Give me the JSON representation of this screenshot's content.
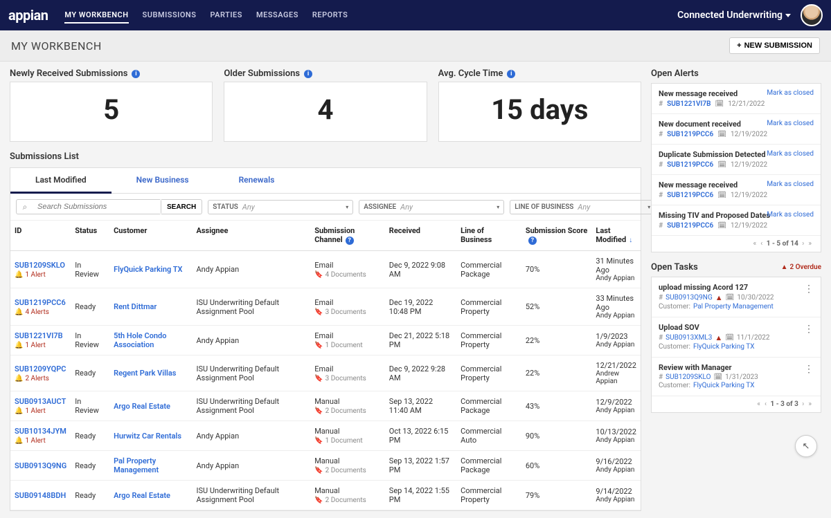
{
  "logo": "appian",
  "nav": [
    "MY WORKBENCH",
    "SUBMISSIONS",
    "PARTIES",
    "MESSAGES",
    "REPORTS"
  ],
  "nav_active": 0,
  "app_name": "Connected Underwriting",
  "page_title": "MY WORKBENCH",
  "new_submission_btn": "NEW SUBMISSION",
  "kpis": [
    {
      "title": "Newly Received Submissions",
      "value": "5"
    },
    {
      "title": "Older Submissions",
      "value": "4"
    },
    {
      "title": "Avg. Cycle Time",
      "value": "15 days"
    }
  ],
  "submissions_title": "Submissions List",
  "sub_tabs": [
    "Last Modified",
    "New Business",
    "Renewals"
  ],
  "sub_tab_active": 0,
  "search_placeholder": "Search Submissions",
  "search_btn": "SEARCH",
  "filters": {
    "status": {
      "label": "STATUS",
      "value": "Any"
    },
    "assignee": {
      "label": "ASSIGNEE",
      "value": "Any"
    },
    "lob": {
      "label": "LINE OF BUSINESS",
      "value": "Any"
    }
  },
  "columns": [
    "ID",
    "Status",
    "Customer",
    "Assignee",
    "Submission Channel",
    "Received",
    "Line of Business",
    "Submission Score",
    "Last Modified"
  ],
  "rows": [
    {
      "id": "SUB1209SKLO",
      "alert": "1 Alert",
      "status": "In Review",
      "customer": "FlyQuick Parking TX",
      "assignee": "Andy Appian",
      "channel": "Email",
      "docs": "4 Documents",
      "received": "Dec 9, 2022 9:08 AM",
      "lob": "Commercial Package",
      "score": "70%",
      "modified": "31 Minutes Ago",
      "mod_by": "Andy Appian"
    },
    {
      "id": "SUB1219PCC6",
      "alert": "4 Alerts",
      "status": "Ready",
      "customer": "Rent Dittmar",
      "assignee": "ISU Underwriting Default Assignment Pool",
      "channel": "Email",
      "docs": "3 Documents",
      "received": "Dec 19, 2022 10:48 PM",
      "lob": "Commercial Property",
      "score": "52%",
      "modified": "33 Minutes Ago",
      "mod_by": "Andy Appian"
    },
    {
      "id": "SUB1221VI7B",
      "alert": "1 Alert",
      "status": "In Review",
      "customer": "5th Hole Condo Association",
      "assignee": "Andy Appian",
      "channel": "Email",
      "docs": "1 Document",
      "received": "Dec 21, 2022 5:18 PM",
      "lob": "Commercial Property",
      "score": "22%",
      "modified": "1/9/2023",
      "mod_by": "Andy Appian"
    },
    {
      "id": "SUB1209YQPC",
      "alert": "2 Alerts",
      "status": "Ready",
      "customer": "Regent Park Villas",
      "assignee": "ISU Underwriting Default Assignment Pool",
      "channel": "Email",
      "docs": "3 Documents",
      "received": "Dec 9, 2022 9:28 AM",
      "lob": "Commercial Property",
      "score": "22%",
      "modified": "12/21/2022",
      "mod_by": "Andrew Appian"
    },
    {
      "id": "SUB0913AUCT",
      "alert": "1 Alert",
      "status": "In Review",
      "customer": "Argo Real Estate",
      "assignee": "ISU Underwriting Default Assignment Pool",
      "channel": "Manual",
      "docs": "2 Documents",
      "received": "Sep 13, 2022 11:40 AM",
      "lob": "Commercial Package",
      "score": "43%",
      "modified": "12/9/2022",
      "mod_by": "Andy Appian"
    },
    {
      "id": "SUB10134JYM",
      "alert": "1 Alert",
      "status": "Ready",
      "customer": "Hurwitz Car Rentals",
      "assignee": "Andy Appian",
      "channel": "Manual",
      "docs": "1 Document",
      "received": "Oct 13, 2022 6:15 PM",
      "lob": "Commercial Auto",
      "score": "90%",
      "modified": "10/13/2022",
      "mod_by": "Andy Appian"
    },
    {
      "id": "SUB0913Q9NG",
      "alert": "",
      "status": "Ready",
      "customer": "Pal Property Management",
      "assignee": "Andy Appian",
      "channel": "Manual",
      "docs": "2 Documents",
      "received": "Sep 13, 2022 1:57 PM",
      "lob": "Commercial Package",
      "score": "60%",
      "modified": "9/16/2022",
      "mod_by": "Andy Appian"
    },
    {
      "id": "SUB09148BDH",
      "alert": "",
      "status": "Ready",
      "customer": "Argo Real Estate",
      "assignee": "ISU Underwriting Default Assignment Pool",
      "channel": "Manual",
      "docs": "2 Documents",
      "received": "Sep 14, 2022 1:55 PM",
      "lob": "Commercial Property",
      "score": "79%",
      "modified": "9/14/2022",
      "mod_by": "Andy Appian"
    }
  ],
  "open_alerts_title": "Open Alerts",
  "mark_closed": "Mark as closed",
  "alerts": [
    {
      "title": "New message received",
      "sub": "SUB1221VI7B",
      "date": "12/21/2022"
    },
    {
      "title": "New document received",
      "sub": "SUB1219PCC6",
      "date": "12/19/2022"
    },
    {
      "title": "Duplicate Submission Detected",
      "sub": "SUB1219PCC6",
      "date": "12/19/2022"
    },
    {
      "title": "New message received",
      "sub": "SUB1219PCC6",
      "date": "12/19/2022"
    },
    {
      "title": "Missing TIV and Proposed Dates",
      "sub": "SUB1219PCC6",
      "date": "12/19/2022"
    }
  ],
  "alerts_pager": "1 - 5 of 14",
  "open_tasks_title": "Open Tasks",
  "overdue_text": "2 Overdue",
  "cust_label": "Customer:",
  "tasks": [
    {
      "title": "upload missing Acord 127",
      "sub": "SUB0913Q9NG",
      "warn": true,
      "date": "10/30/2022",
      "customer": "Pal Property Management"
    },
    {
      "title": "Upload SOV",
      "sub": "SUB0913XML3",
      "warn": true,
      "date": "11/1/2022",
      "customer": "FlyQuick Parking TX"
    },
    {
      "title": "Review with Manager",
      "sub": "SUB1209SKLO",
      "warn": false,
      "date": "1/31/2023",
      "customer": "FlyQuick Parking TX"
    }
  ],
  "tasks_pager": "1 - 3 of 3"
}
